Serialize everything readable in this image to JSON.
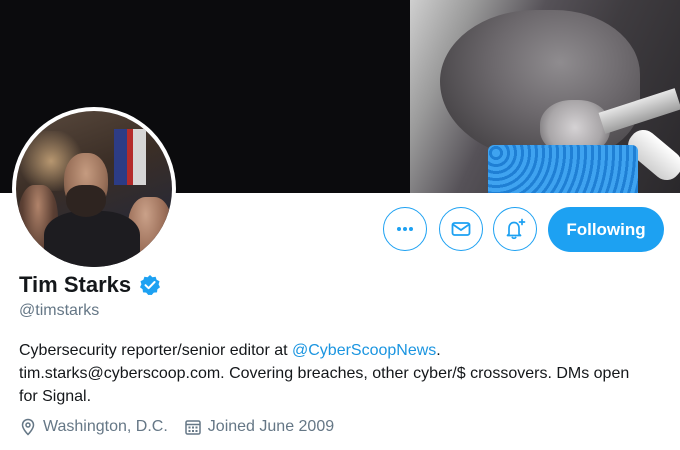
{
  "profile": {
    "name": "Tim Starks",
    "handle": "@timstarks",
    "verified": true,
    "bio_part1": "Cybersecurity reporter/senior editor at ",
    "bio_mention": "@CyberScoopNews",
    "bio_part2": ".",
    "bio_line2": "tim.starks@cyberscoop.com. Covering breaches, other cyber/$ crossovers. DMs open",
    "bio_line3": "for Signal.",
    "location": "Washington, D.C.",
    "joined": "Joined June 2009"
  },
  "actions": {
    "more_icon": "more-icon",
    "message_icon": "envelope-icon",
    "notify_icon": "bell-plus-icon",
    "follow_label": "Following"
  },
  "colors": {
    "accent": "#1da1f2",
    "link": "#1b95e0",
    "secondary_text": "#657786",
    "banner_bg": "#0b0b0d"
  }
}
